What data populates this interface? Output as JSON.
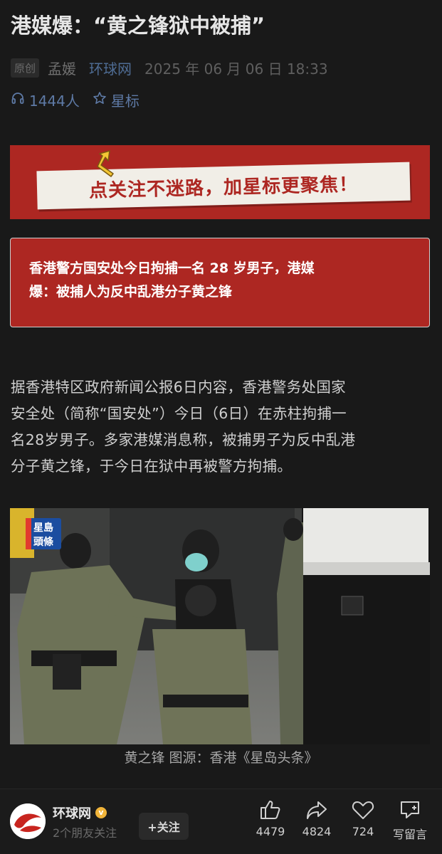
{
  "article": {
    "title": "港媒爆：“黄之锋狱中被捕”",
    "tag": "原创",
    "author": "孟媛",
    "source": "环球网",
    "date": "2025 年 06 月 06 日  18:33",
    "listeners": "1444人",
    "star_label": "星标"
  },
  "banner": {
    "text": "点关注不迷路，加星标更聚焦！"
  },
  "headline": {
    "line1": "香港警方国安处今日拘捕一名 28 岁男子，港媒",
    "line2": "爆：被捕人为反中乱港分子黄之锋"
  },
  "body": {
    "lines": [
      "据香港特区政府新闻公报6日内容，香港警务处国家",
      "安全处（简称“国安处”）今日（6日）在赤柱拘捕一",
      "名28岁男子。多家港媒消息称，被捕男子为反中乱港",
      "分子黄之锋，于今日在狱中再被警方拘捕。"
    ]
  },
  "photo": {
    "watermark_line1": "星島",
    "watermark_line2": "頭條",
    "caption": "黄之锋  图源：香港《星岛头条》"
  },
  "footer": {
    "account_name": "环球网",
    "account_sub": "2个朋友关注",
    "follow_label": "+关注",
    "like_count": "4479",
    "share_count": "4824",
    "heart_count": "724",
    "comment_label": "写留言"
  },
  "colors": {
    "background": "#191919",
    "accent_red": "#ad2722",
    "link_blue": "#4f6d95"
  }
}
